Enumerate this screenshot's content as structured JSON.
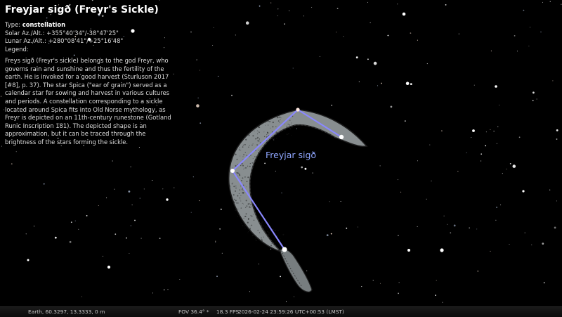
{
  "info": {
    "title": "Freyjar sigð (Freyr's Sickle)",
    "type_label": "Type:",
    "type_value": "constellation",
    "solar": "Solar Az./Alt.: +355°40'34\"/-38°47'25\"",
    "lunar": "Lunar Az./Alt.: +280°08'41\"/+25°16'48\"",
    "legend_label": "Legend:",
    "description": "Freys sigð (Freyr's sickle) belongs to the god Freyr, who governs rain and sunshine and thus the fertility of the earth. He is invoked for a good harvest (Sturluson 2017 [#8], p. 37). The star Spica (\"ear of grain\") served as a calendar star for sowing and harvest in various cultures and periods. A constellation corresponding to a sickle located around Spica fits into Old Norse mythology, as Freyr is depicted on an 11th-century runestone (Gotland Runic Inscription 181). The depicted shape is an approximation, but it can be traced through the brightness of the stars forming the sickle."
  },
  "constellation": {
    "label": "Freyjar sigð"
  },
  "status": {
    "location": "Earth, 60.3297, 13.3333, 0 m",
    "fov": "FOV 36.4° *",
    "fps": "18.3 FPS",
    "datetime": "2026-02-24 23:59:26 UTC+00:53 (LMST)"
  },
  "colors": {
    "background": "#000000",
    "constellation_line": "#8a88ff",
    "constellation_label": "#8fa6ff",
    "sickle_fill": "#8d9395"
  }
}
